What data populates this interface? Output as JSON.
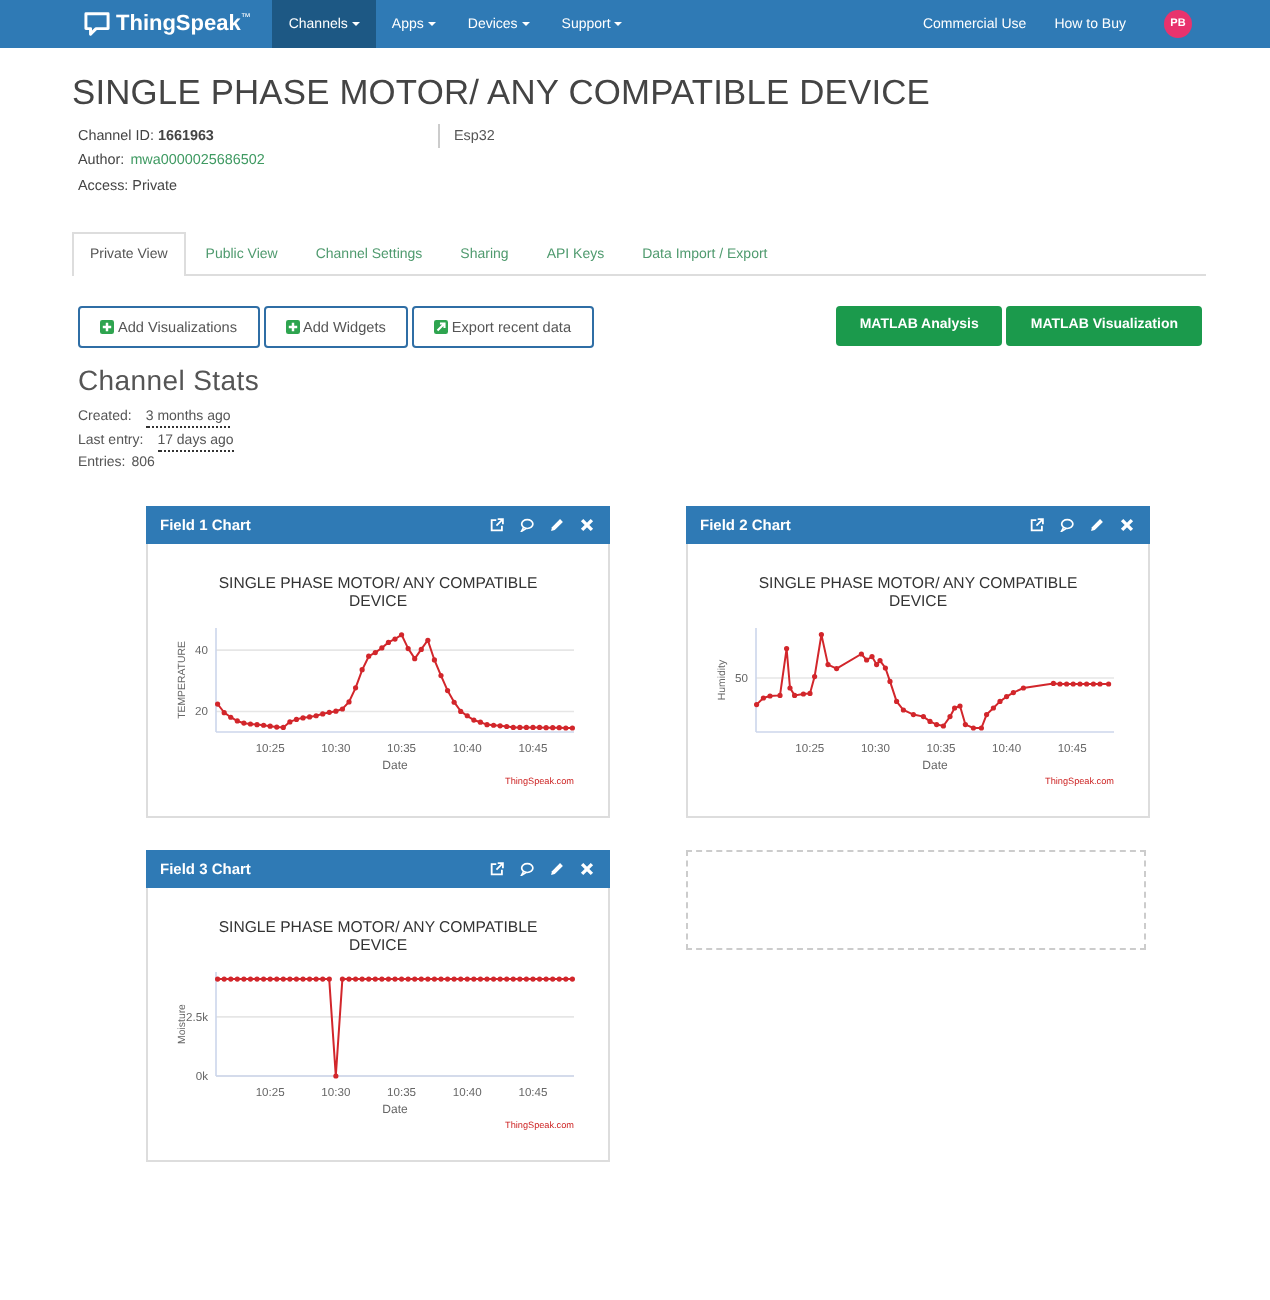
{
  "nav": {
    "logo": "ThingSpeak$^{™}$",
    "menu": [
      {
        "label": "Channels",
        "selected": true
      },
      {
        "label": "Apps",
        "selected": false
      },
      {
        "label": "Devices",
        "selected": false
      },
      {
        "label": "Support",
        "selected": false
      }
    ],
    "links": [
      "Commercial Use",
      "How to Buy"
    ],
    "avatar": "PB"
  },
  "channel": {
    "title": "SINGLE PHASE MOTOR/ ANY COMPATIBLE DEVICE",
    "id_line": "Channel ID: **1661963**",
    "author_label": "Author:",
    "author": "mwa0000025686502",
    "access": "Access: Private",
    "description": "Esp32"
  },
  "tabs": [
    {
      "label": "Private View",
      "selected": true
    },
    {
      "label": "Public View",
      "selected": false
    },
    {
      "label": "Channel Settings",
      "selected": false
    },
    {
      "label": "Sharing",
      "selected": false
    },
    {
      "label": "API Keys",
      "selected": false
    },
    {
      "label": "Data Import / Export",
      "selected": false
    }
  ],
  "actions": [
    {
      "label": "Add Visualizations",
      "kind": "add"
    },
    {
      "label": "Add Widgets",
      "kind": "add"
    },
    {
      "label": "Export recent data",
      "kind": "export"
    }
  ],
  "matlab_buttons": [
    "MATLAB Analysis",
    "MATLAB Visualization"
  ],
  "stats": {
    "heading": "Channel Stats",
    "items": [
      {
        "label": "Created:",
        "value": "3 months ago",
        "kind": "time"
      },
      {
        "label": "Last entry:",
        "value": "17 days ago",
        "kind": "time"
      },
      {
        "label": "Entries:",
        "value": "806",
        "kind": "count"
      }
    ]
  },
  "charts": [
    {
      "kind": "data",
      "header": "Field 1 Chart",
      "credit": "ThingSpeak.com",
      "chart_data": {
        "type": "line",
        "title": "SINGLE PHASE MOTOR/ ANY COMPATIBLE DEVICE",
        "xlabel": "Date",
        "ylabel": "TEMPERATURE",
        "categories": [
          null,
          null,
          null,
          null,
          null,
          null,
          null,
          null,
          "10:25",
          null,
          null,
          null,
          null,
          null,
          null,
          null,
          null,
          null,
          "10:30",
          null,
          null,
          null,
          null,
          null,
          null,
          null,
          null,
          null,
          "10:35",
          null,
          null,
          null,
          null,
          null,
          null,
          null,
          null,
          null,
          "10:40",
          null,
          null,
          null,
          null,
          null,
          null,
          null,
          null,
          null,
          "10:45",
          null,
          null,
          null,
          null,
          null,
          null
        ],
        "values": [
          22.4,
          19.6,
          18.1,
          16.9,
          16.2,
          15.9,
          15.7,
          15.5,
          15.2,
          14.9,
          14.8,
          16.6,
          17.4,
          17.9,
          18.2,
          18.6,
          19.2,
          19.7,
          20.1,
          20.8,
          23.1,
          27.7,
          33.6,
          38,
          39.2,
          40.7,
          42.5,
          43.6,
          45,
          40.5,
          37.2,
          40.2,
          43.2,
          36.8,
          31.7,
          26.8,
          23,
          20,
          18.6,
          17.2,
          16.5,
          15.7,
          15.5,
          15.3,
          15.1,
          14.8,
          14.8,
          14.8,
          14.8,
          14.8,
          14.7,
          14.7,
          14.7,
          14.6,
          14.6
        ],
        "ylim": [
          13.3,
          47.2
        ],
        "yticks": [
          20,
          40
        ]
      }
    },
    {
      "kind": "picture",
      "header": "Field 2 Chart",
      "credit": "ThingSpeak.com",
      "title": "SINGLE PHASE MOTOR/ ANY COMPATIBLE DEVICE",
      "xlabel": "Date",
      "ylabel": "Humidity",
      "xticks": [
        "10:25",
        "10:30",
        "10:35",
        "10:40",
        "10:45"
      ],
      "yticks": [
        "50"
      ]
    },
    {
      "kind": "data",
      "header": "Field 3 Chart",
      "credit": "ThingSpeak.com",
      "chart_data": {
        "type": "line",
        "title": "SINGLE PHASE MOTOR/ ANY COMPATIBLE DEVICE",
        "xlabel": "Date",
        "ylabel": "Moisture",
        "categories": [
          null,
          null,
          null,
          null,
          null,
          null,
          null,
          null,
          "10:25",
          null,
          null,
          null,
          null,
          null,
          null,
          null,
          null,
          null,
          "10:30",
          null,
          null,
          null,
          null,
          null,
          null,
          null,
          null,
          null,
          "10:35",
          null,
          null,
          null,
          null,
          null,
          null,
          null,
          null,
          null,
          "10:40",
          null,
          null,
          null,
          null,
          null,
          null,
          null,
          null,
          null,
          "10:45",
          null,
          null,
          null,
          null,
          null,
          null
        ],
        "values": [
          4100,
          4100,
          4100,
          4100,
          4100,
          4100,
          4100,
          4100,
          4100,
          4100,
          4100,
          4100,
          4100,
          4100,
          4100,
          4100,
          4100,
          4100,
          0,
          4100,
          4100,
          4100,
          4100,
          4100,
          4100,
          4100,
          4100,
          4100,
          4100,
          4100,
          4100,
          4100,
          4100,
          4100,
          4100,
          4100,
          4100,
          4100,
          4100,
          4100,
          4100,
          4100,
          4100,
          4100,
          4100,
          4100,
          4100,
          4100,
          4100,
          4100,
          4100,
          4100,
          4100,
          4100,
          4100
        ],
        "ylim": [
          0,
          4400
        ],
        "yticks": [
          {
            "value": 0,
            "label": "0k"
          },
          {
            "value": 2500,
            "label": "2.5k"
          }
        ]
      }
    }
  ]
}
